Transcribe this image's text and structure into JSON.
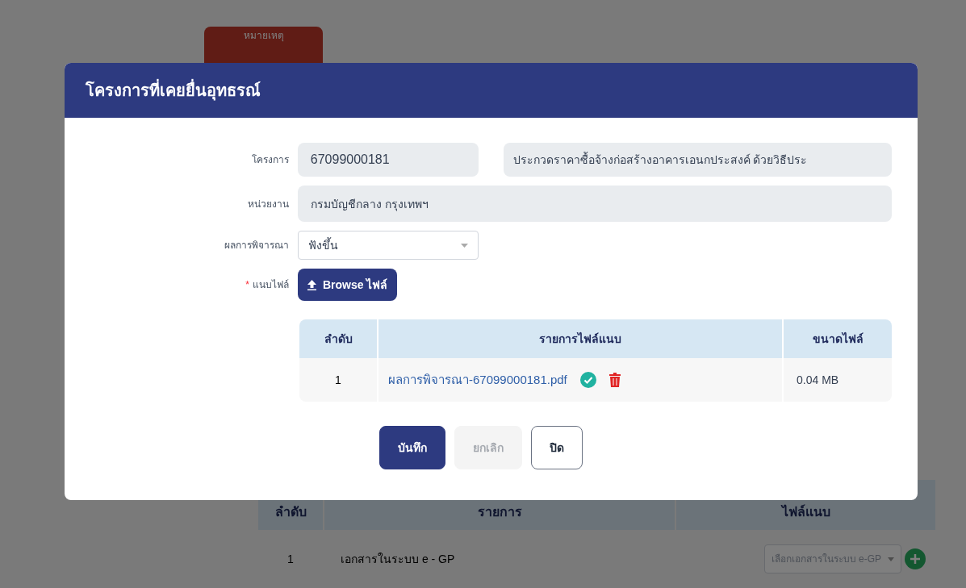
{
  "background": {
    "tab": "หมายเหตุ",
    "table": {
      "columns": [
        "ลำดับ",
        "รายการ",
        "ไฟล์แนบ"
      ],
      "rows": [
        {
          "index": "1",
          "item": "เอกสารในระบบ e - GP",
          "select_placeholder": "เลือกเอกสารในระบบ e-GP"
        }
      ]
    }
  },
  "dialog": {
    "title": "โครงการที่เคยยื่นอุทธรณ์",
    "fields": [
      {
        "label": "โครงการ",
        "kind": "pair",
        "values": [
          "67099000181",
          "ประกวดราคาซื้อจ้างก่อสร้างอาคารเอนกประสงค์ ด้วยวิธีประ"
        ]
      },
      {
        "label": "หน่วยงาน",
        "kind": "text",
        "values": [
          "กรมบัญชีกลาง กรุงเทพฯ"
        ]
      },
      {
        "label": "ผลการพิจารณา",
        "kind": "select",
        "values": [
          "ฟังขึ้น"
        ]
      },
      {
        "label": "แนบไฟล์",
        "kind": "upload",
        "required": true,
        "required_mark": "*",
        "button": "Browse ไฟล์"
      }
    ],
    "files": {
      "columns": [
        "ลำดับ",
        "รายการไฟล์แนบ",
        "ขนาดไฟล์"
      ],
      "rows": [
        {
          "index": "1",
          "name": "ผลการพิจารณา-67099000181.pdf",
          "verified": true,
          "size": "0.04 MB"
        }
      ]
    },
    "buttons": [
      {
        "label": "บันทึก",
        "kind": "primary",
        "disabled": false
      },
      {
        "label": "ยกเลิก",
        "kind": "secondary",
        "disabled": true
      },
      {
        "label": "ปิด",
        "kind": "outline",
        "disabled": false
      }
    ]
  }
}
